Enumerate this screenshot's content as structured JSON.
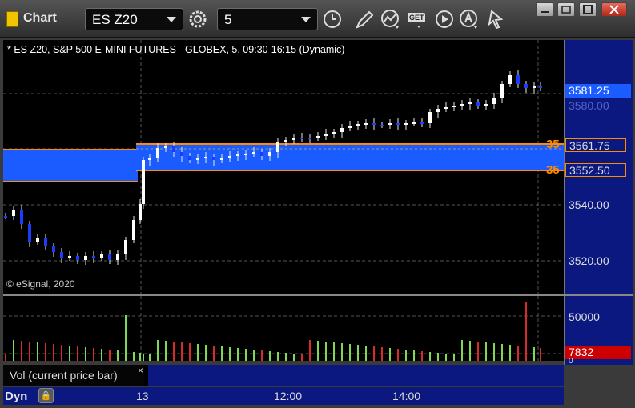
{
  "window": {
    "title": "Chart"
  },
  "toolbar": {
    "symbol": "ES Z20",
    "interval": "5",
    "icons": [
      "settings-gear-icon",
      "clock-icon",
      "pencil-icon",
      "studies-icon",
      "get-icon",
      "play-icon",
      "alert-icon",
      "cursor-icon"
    ],
    "get_label": "GET"
  },
  "chart": {
    "header": "* ES Z20, S&P 500 E-MINI FUTURES - GLOBEX, 5, 09:30-16:15 (Dynamic)",
    "copyright": "© eSignal, 2020",
    "price_labels": [
      "3581.25",
      "3580.00",
      "3561.75",
      "3552.50",
      "3540.00",
      "3520.00"
    ],
    "upper_order_qty": "35",
    "lower_order_qty": "35",
    "colors": {
      "band": "#1a5cff",
      "order_line": "#ff8c00",
      "last_price_bg": "#1a5cff"
    }
  },
  "volume": {
    "labels": [
      "50000",
      "7832",
      "0"
    ],
    "study_label": "Vol (current price bar)",
    "close_glyph": "×",
    "current_bg": "#cc0000"
  },
  "time_axis": {
    "labels": [
      "13",
      "12:00",
      "14:00"
    ]
  },
  "footer": {
    "mode_label": "Dyn"
  }
}
